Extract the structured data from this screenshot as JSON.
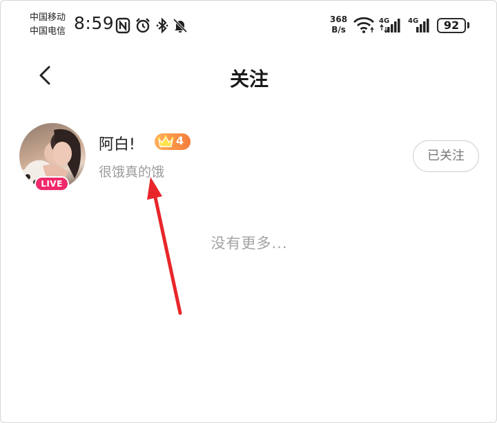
{
  "status_bar": {
    "carrier_1": "中国移动",
    "carrier_2": "中国电信",
    "time": "8:59",
    "net_speed_value": "368",
    "net_speed_unit": "B/s",
    "signal_1_label": "4G",
    "signal_2_label": "4G",
    "battery": "92",
    "icons": [
      "nfc-icon",
      "alarm-icon",
      "bluetooth-icon",
      "mute-icon",
      "wifi-icon",
      "signal-icon",
      "battery-icon"
    ]
  },
  "header": {
    "title": "关注",
    "back_icon": "chevron-left-icon"
  },
  "follow_list": [
    {
      "name": "阿白!",
      "level": "4",
      "signature": "很饿真的饿",
      "live_label": "LIVE",
      "button_label": "已关注"
    }
  ],
  "footer": {
    "no_more": "没有更多..."
  },
  "colors": {
    "live": "#f0296a",
    "level_badge": "#f47b3a",
    "annotation_arrow": "#e8262a"
  }
}
